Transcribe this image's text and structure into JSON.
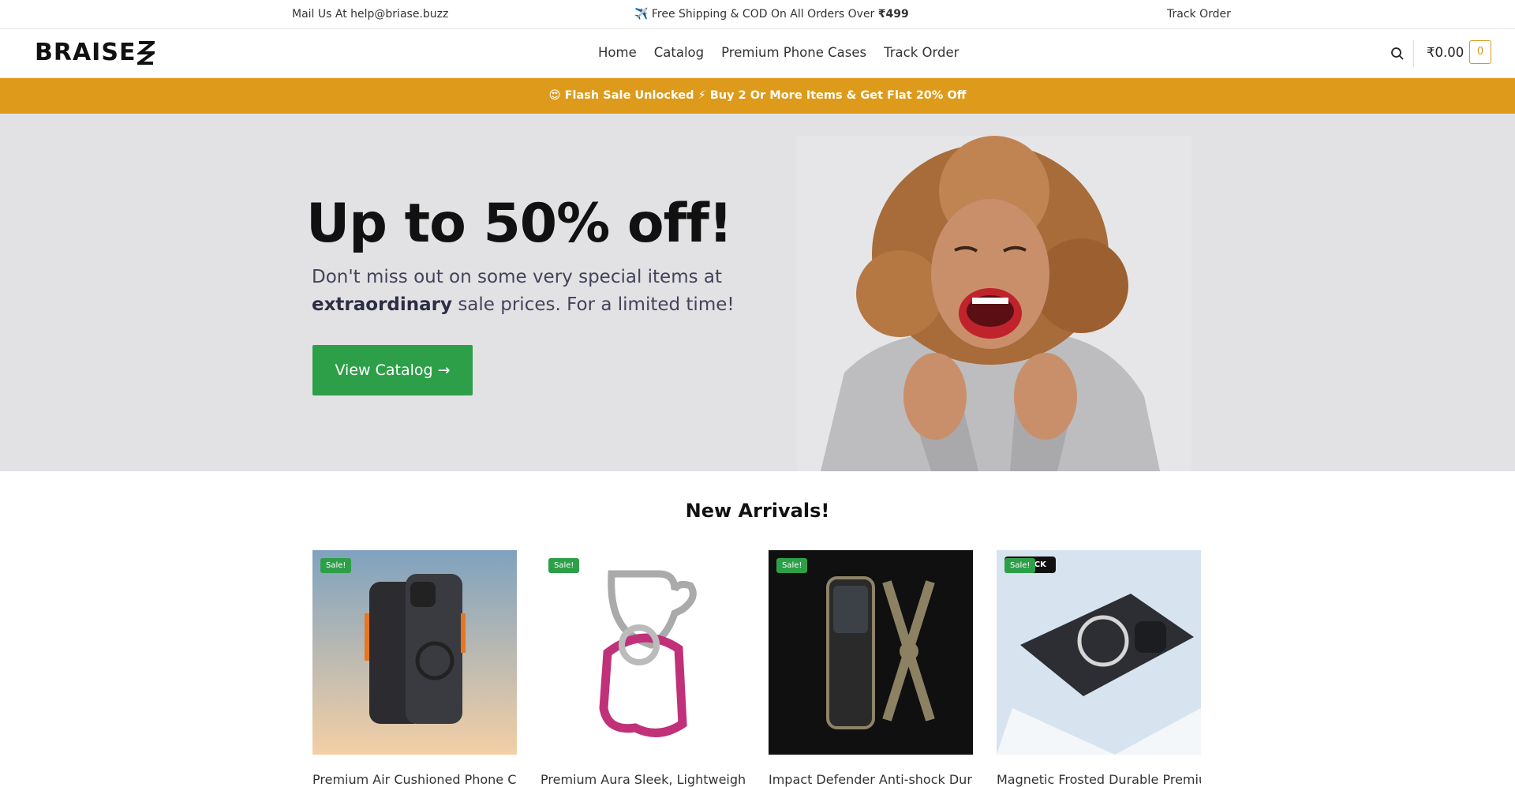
{
  "topbar": {
    "mail": "Mail Us At help@briase.buzz",
    "shipping_prefix": "✈️ Free Shipping & COD On All Orders Over ",
    "shipping_amount": "₹499",
    "track": "Track Order"
  },
  "header": {
    "logo": "BRAISE",
    "nav": [
      "Home",
      "Catalog",
      "Premium Phone Cases",
      "Track Order"
    ],
    "cart_total": "₹0.00",
    "cart_count": "0"
  },
  "flash_banner": "😍 Flash Sale Unlocked ⚡ Buy 2 Or More Items & Get Flat 20% Off",
  "hero": {
    "title": "Up to 50% off!",
    "text_before": "Don't miss out on some very special items at ",
    "text_bold": "extraordinary",
    "text_after": " sale prices. For a limited time!",
    "button": "View Catalog →"
  },
  "new_arrivals": {
    "title": "New Arrivals!",
    "products": [
      {
        "name": "Premium Air Cushioned Phone Case",
        "badge": "Sale!"
      },
      {
        "name": "Premium Aura Sleek, Lightweight &",
        "badge": "Sale!"
      },
      {
        "name": "Impact Defender Anti-shock Durable",
        "badge": "Sale!"
      },
      {
        "name": "Magnetic Frosted Durable Premium",
        "badge": "Sale!",
        "extra_badge": "ACK"
      }
    ]
  },
  "colors": {
    "accent_orange": "#de9a1b",
    "button_green": "#2e9f49",
    "hero_bg": "#e2e2e5"
  }
}
